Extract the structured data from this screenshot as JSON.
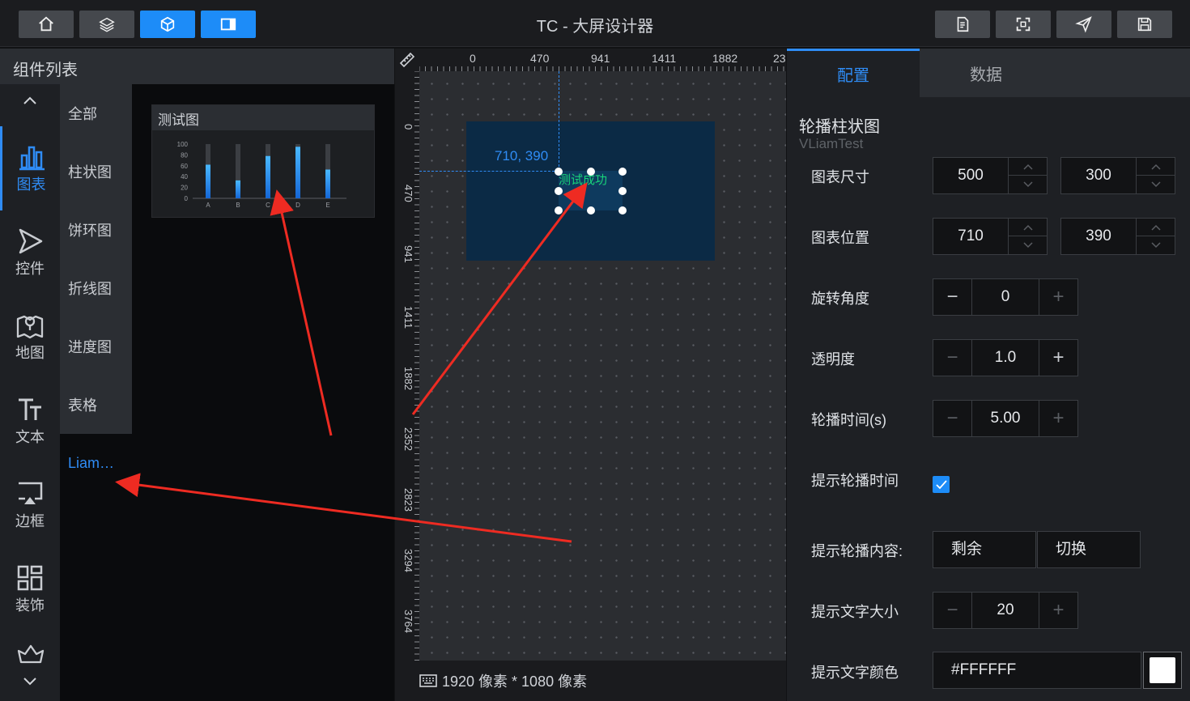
{
  "app": {
    "title": "TC - 大屏设计器"
  },
  "left_panel": {
    "header": "组件列表",
    "categories": [
      {
        "label": "图表",
        "icon": "bar-chart-icon",
        "active": true
      },
      {
        "label": "控件",
        "icon": "play-outline-icon"
      },
      {
        "label": "地图",
        "icon": "map-icon"
      },
      {
        "label": "文本",
        "icon": "text-icon"
      },
      {
        "label": "边框",
        "icon": "border-frame-icon"
      },
      {
        "label": "装饰",
        "icon": "grid-decor-icon"
      }
    ],
    "subcategories": [
      "全部",
      "柱状图",
      "饼环图",
      "折线图",
      "进度图",
      "表格",
      "Liam…"
    ],
    "preview": {
      "title": "测试图",
      "chart_data": {
        "type": "bar",
        "categories": [
          "A",
          "B",
          "C",
          "D",
          "E"
        ],
        "values": [
          62,
          33,
          78,
          95,
          53
        ],
        "ylim": [
          0,
          100
        ],
        "yticks": [
          0,
          20,
          40,
          60,
          80,
          100
        ]
      }
    }
  },
  "canvas": {
    "ruler_top_ticks": [
      "0",
      "470",
      "941",
      "1411",
      "1882",
      "23"
    ],
    "ruler_left_ticks": [
      "0",
      "470",
      "941",
      "1411",
      "1882",
      "2352",
      "2823",
      "3294",
      "3764"
    ],
    "cursor_readout": "710, 390",
    "widget_text": "测试成功",
    "status": "1920 像素 * 1080 像素"
  },
  "right_panel": {
    "tabs": [
      "配置",
      "数据"
    ],
    "component_name": "轮播柱状图",
    "component_id": "VLiamTest",
    "fields": {
      "size_label": "图表尺寸",
      "width": "500",
      "height": "300",
      "pos_label": "图表位置",
      "x": "710",
      "y": "390",
      "rotate_label": "旋转角度",
      "rotate": "0",
      "opacity_label": "透明度",
      "opacity": "1.0",
      "interval_label": "轮播时间(s)",
      "interval": "5.00",
      "show_time_label": "提示轮播时间",
      "content_label": "提示轮播内容:",
      "content_options": [
        "剩余",
        "切换"
      ],
      "fontsize_label": "提示文字大小",
      "fontsize": "20",
      "color_label": "提示文字颜色",
      "color": "#FFFFFF"
    }
  },
  "colors": {
    "accent": "#1d8cf8",
    "annotation": "#ee2b22",
    "success_text": "#18d27a"
  }
}
